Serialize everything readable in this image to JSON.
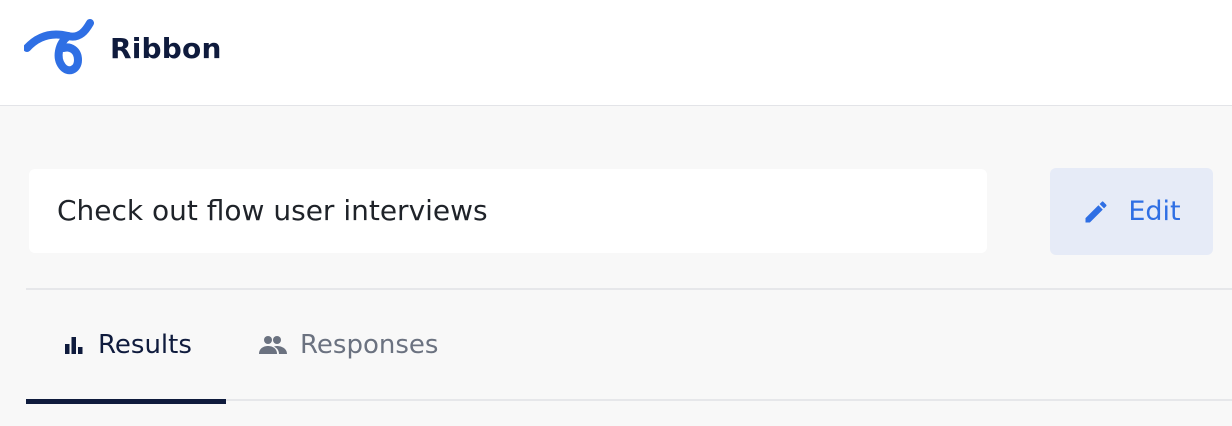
{
  "app": {
    "brand_name": "Ribbon",
    "logo_icon": "ribbon-logo-icon",
    "brand_color": "#2f6fe4"
  },
  "survey": {
    "title": "Check out flow user interviews"
  },
  "toolbar": {
    "edit_label": "Edit",
    "edit_icon": "pencil-icon"
  },
  "tabs": [
    {
      "label": "Results",
      "icon": "bar-chart-icon",
      "active": true
    },
    {
      "label": "Responses",
      "icon": "people-icon",
      "active": false
    }
  ],
  "colors": {
    "accent": "#2f6fe4",
    "navy": "#0f1b3d",
    "muted": "#6b7280",
    "edit_bg": "#e6ebf7"
  }
}
